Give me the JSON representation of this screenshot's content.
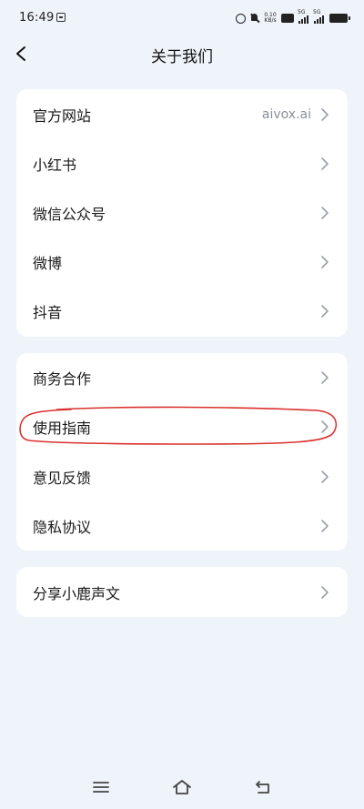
{
  "status_bar": {
    "time": "16:49",
    "net_speed_value": "0.10",
    "net_speed_unit": "KB/s",
    "sim1_label": "5G",
    "sim2_label": "5G"
  },
  "header": {
    "title": "关于我们",
    "back_icon": "chevron-left-icon"
  },
  "groups": [
    {
      "items": [
        {
          "label": "官方网站",
          "value": "aivox.ai"
        },
        {
          "label": "小红书"
        },
        {
          "label": "微信公众号"
        },
        {
          "label": "微博"
        },
        {
          "label": "抖音"
        }
      ]
    },
    {
      "items": [
        {
          "label": "商务合作"
        },
        {
          "label": "使用指南"
        },
        {
          "label": "意见反馈"
        },
        {
          "label": "隐私协议"
        }
      ]
    },
    {
      "items": [
        {
          "label": "分享小鹿声文"
        }
      ]
    }
  ],
  "annotation": {
    "color": "#d9322e"
  },
  "nav": {
    "menu_icon": "menu-icon",
    "home_icon": "home-icon",
    "back_icon": "back-arrow-icon"
  },
  "colors": {
    "background": "#eff3fa",
    "card": "#ffffff",
    "secondary_text": "#8a8f99",
    "chevron": "#9aa0aa"
  }
}
